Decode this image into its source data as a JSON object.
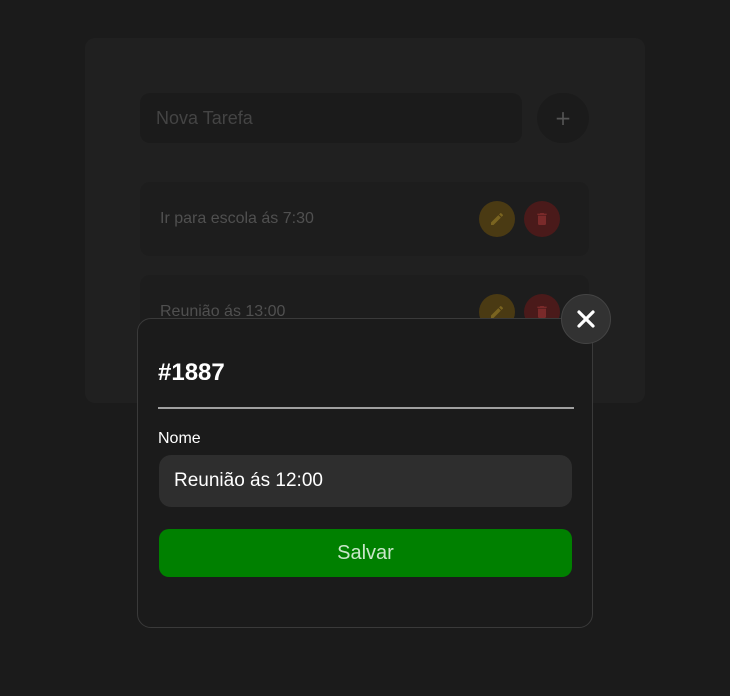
{
  "background_app": {
    "new_task": {
      "placeholder": "Nova Tarefa"
    },
    "add_button_label": "+",
    "tasks": [
      {
        "label": "Ir para escola ás 7:30"
      },
      {
        "label": "Reunião ás 13:00"
      }
    ],
    "colors": {
      "edit": "#4a3a13",
      "delete": "#4a1a1a"
    }
  },
  "modal": {
    "title": "#1887",
    "field_label": "Nome",
    "name_value": "Reunião ás 12:00",
    "save_label": "Salvar",
    "colors": {
      "save": "#008000"
    }
  }
}
